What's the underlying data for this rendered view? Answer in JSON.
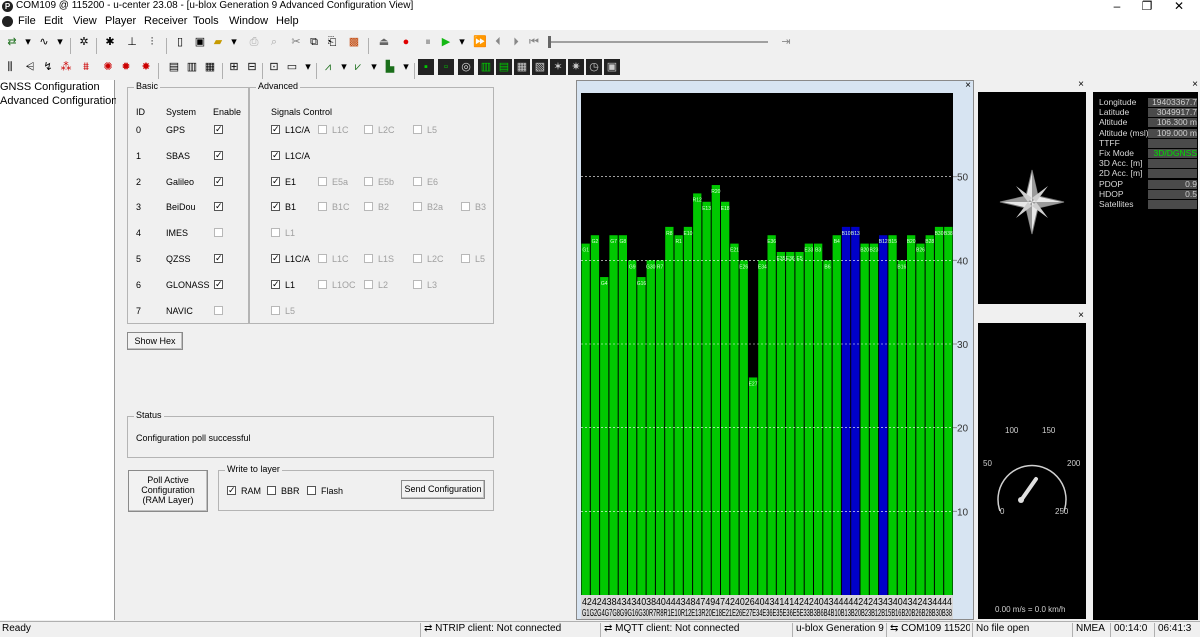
{
  "window": {
    "title": "COM109 @ 115200 - u-center 23.08 - [u-blox Generation 9 Advanced Configuration View]",
    "icon_letter": "P",
    "controls": [
      "–",
      "❐",
      "✕"
    ]
  },
  "menu": [
    "File",
    "Edit",
    "View",
    "Player",
    "Receiver",
    "Tools",
    "Window",
    "Help"
  ],
  "nav": {
    "items": [
      "GNSS Configuration",
      "Advanced Configuration"
    ]
  },
  "config": {
    "basic_title": "Basic",
    "advanced_title": "Advanced",
    "col_id": "ID",
    "col_system": "System",
    "col_enable": "Enable",
    "signals_control": "Signals Control",
    "systems": [
      {
        "id": "0",
        "name": "GPS",
        "enabled": true,
        "signals": [
          {
            "label": "L1C/A",
            "checked": true,
            "enabled": true
          },
          {
            "label": "L1C",
            "checked": false,
            "enabled": false
          },
          {
            "label": "L2C",
            "checked": false,
            "enabled": false
          },
          {
            "label": "L5",
            "checked": false,
            "enabled": false
          }
        ]
      },
      {
        "id": "1",
        "name": "SBAS",
        "enabled": true,
        "signals": [
          {
            "label": "L1C/A",
            "checked": true,
            "enabled": true
          }
        ]
      },
      {
        "id": "2",
        "name": "Galileo",
        "enabled": true,
        "signals": [
          {
            "label": "E1",
            "checked": true,
            "enabled": true
          },
          {
            "label": "E5a",
            "checked": false,
            "enabled": false
          },
          {
            "label": "E5b",
            "checked": false,
            "enabled": false
          },
          {
            "label": "E6",
            "checked": false,
            "enabled": false
          }
        ]
      },
      {
        "id": "3",
        "name": "BeiDou",
        "enabled": true,
        "signals": [
          {
            "label": "B1",
            "checked": true,
            "enabled": true
          },
          {
            "label": "B1C",
            "checked": false,
            "enabled": false
          },
          {
            "label": "B2",
            "checked": false,
            "enabled": false
          },
          {
            "label": "B2a",
            "checked": false,
            "enabled": false
          },
          {
            "label": "B3",
            "checked": false,
            "enabled": false
          }
        ]
      },
      {
        "id": "4",
        "name": "IMES",
        "enabled": false,
        "signals": [
          {
            "label": "L1",
            "checked": false,
            "enabled": false
          }
        ]
      },
      {
        "id": "5",
        "name": "QZSS",
        "enabled": true,
        "signals": [
          {
            "label": "L1C/A",
            "checked": true,
            "enabled": true
          },
          {
            "label": "L1C",
            "checked": false,
            "enabled": false
          },
          {
            "label": "L1S",
            "checked": false,
            "enabled": false
          },
          {
            "label": "L2C",
            "checked": false,
            "enabled": false
          },
          {
            "label": "L5",
            "checked": false,
            "enabled": false
          }
        ]
      },
      {
        "id": "6",
        "name": "GLONASS",
        "enabled": true,
        "signals": [
          {
            "label": "L1",
            "checked": true,
            "enabled": true
          },
          {
            "label": "L1OC",
            "checked": false,
            "enabled": false
          },
          {
            "label": "L2",
            "checked": false,
            "enabled": false
          },
          {
            "label": "L3",
            "checked": false,
            "enabled": false
          }
        ]
      },
      {
        "id": "7",
        "name": "NAVIC",
        "enabled": false,
        "signals": [
          {
            "label": "L5",
            "checked": false,
            "enabled": false
          }
        ]
      }
    ],
    "show_hex": "Show Hex",
    "status_title": "Status",
    "status_text": "Configuration poll successful",
    "poll_button": "Poll Active Configuration (RAM Layer)",
    "write_title": "Write to layer",
    "layers": [
      {
        "label": "RAM",
        "checked": true
      },
      {
        "label": "BBR",
        "checked": false
      },
      {
        "label": "Flash",
        "checked": false
      }
    ],
    "send_button": "Send Configuration"
  },
  "chart_data": {
    "type": "bar",
    "ylim": [
      0,
      60
    ],
    "yticks": [
      10,
      20,
      30,
      40,
      50
    ],
    "categories": [
      "G1",
      "G2",
      "G4",
      "G7",
      "G8",
      "G9",
      "G16",
      "G30",
      "R7",
      "R8",
      "R1",
      "E10",
      "R12",
      "E13",
      "R20",
      "E18",
      "E21",
      "E26",
      "E27",
      "E34",
      "E36",
      "E35",
      "E36",
      "E5",
      "E33",
      "B3",
      "B6",
      "B4",
      "B10",
      "B13",
      "B20",
      "B23",
      "B12",
      "B15",
      "B16",
      "B20",
      "B26",
      "B28",
      "B30",
      "B38"
    ],
    "values": [
      42,
      43,
      38,
      43,
      43,
      40,
      38,
      40,
      40,
      44,
      43,
      44,
      48,
      47,
      49,
      47,
      42,
      40,
      26,
      40,
      43,
      41,
      41,
      41,
      42,
      42,
      40,
      43,
      44,
      44,
      42,
      42,
      43,
      43,
      40,
      43,
      42,
      43,
      44,
      44
    ],
    "bar_labels": [
      "G1",
      "G2",
      "G4",
      "G7",
      "G8",
      "G9",
      "G16",
      "G30",
      "R7",
      "R8",
      "R1",
      "E10",
      "R12",
      "E13",
      "R20",
      "E18",
      "E21",
      "E26",
      "E27",
      "E34",
      "E36",
      "E35",
      "E36",
      "E5",
      "E33",
      "B3",
      "B6",
      "B4",
      "B10",
      "B13",
      "B20",
      "B23",
      "B12",
      "B15",
      "B16",
      "B20",
      "B26",
      "B28",
      "B30",
      "B38"
    ],
    "colors": [
      "#00c800",
      "#00c800",
      "#00c800",
      "#00c800",
      "#00c800",
      "#00c800",
      "#00c800",
      "#00c800",
      "#00c800",
      "#00c800",
      "#00c800",
      "#00c800",
      "#00c800",
      "#00c800",
      "#00c800",
      "#00c800",
      "#00c800",
      "#00c800",
      "#00c800",
      "#00c800",
      "#00c800",
      "#00c800",
      "#00c800",
      "#00c800",
      "#00c800",
      "#00c800",
      "#00c800",
      "#00c800",
      "#0000c8",
      "#0000c8",
      "#00c800",
      "#00c800",
      "#0000c8",
      "#00c800",
      "#00c800",
      "#00c800",
      "#00c800",
      "#00c800",
      "#00c800",
      "#00c800"
    ],
    "bottom_values": "424243843434038404443484749474240264043414142424043444442424343404342434444",
    "bottom_labels": "G1G2G4G7G8G9G16G30R7R8R1E10R12E13R20E18E21E26E27E34E36E35E36E5E33B3B6B4B10B13B20B23B12B15B16B20B26B28B30B38",
    "sky_plot": "compass",
    "speed": {
      "ticks": [
        "0",
        "50",
        "100",
        "150",
        "200",
        "250"
      ],
      "readout": "0.00 m/s = 0.0 km/h",
      "value": 0
    }
  },
  "datapanel": {
    "rows": [
      {
        "key": "Longitude",
        "val": "19403367.7"
      },
      {
        "key": "Latitude",
        "val": "3049917.7"
      },
      {
        "key": "Altitude",
        "val": "106.300 m"
      },
      {
        "key": "Altitude (msl)",
        "val": "109.000 m"
      },
      {
        "key": "TTFF",
        "val": ""
      },
      {
        "key": "Fix Mode",
        "val": "3D/DGNSS"
      },
      {
        "key": "3D Acc. [m]",
        "val": ""
      },
      {
        "key": "2D Acc. [m]",
        "val": ""
      },
      {
        "key": "PDOP",
        "val": "0.9"
      },
      {
        "key": "HDOP",
        "val": "0.5"
      },
      {
        "key": "Satellites",
        "val": ""
      }
    ]
  },
  "statusbar": {
    "ready": "Ready",
    "ntrip": "NTRIP client: Not connected",
    "mqtt": "MQTT client: Not connected",
    "gen": "u-blox Generation 9",
    "port": "COM109 115200",
    "file": "No file open",
    "protocol": "NMEA",
    "elapsed": "00:14:0",
    "clock": "06:41:3"
  }
}
